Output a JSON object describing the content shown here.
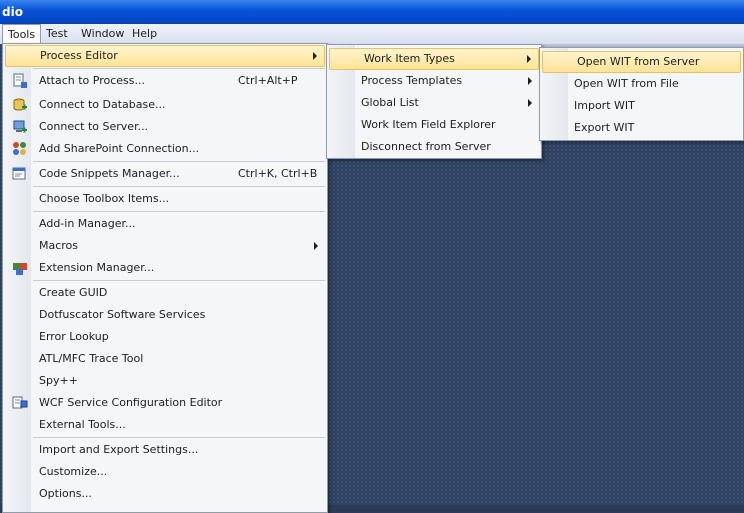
{
  "window": {
    "title_fragment": "dio"
  },
  "menubar": {
    "items": [
      "Tools",
      "Test",
      "Window",
      "Help"
    ]
  },
  "tools_menu": {
    "items": [
      {
        "label": "Process Editor",
        "has_submenu": true
      },
      {
        "label": "Attach to Process...",
        "shortcut": "Ctrl+Alt+P"
      },
      {
        "label": "Connect to Database..."
      },
      {
        "label": "Connect to Server..."
      },
      {
        "label": "Add SharePoint Connection..."
      },
      {
        "label": "Code Snippets Manager...",
        "shortcut": "Ctrl+K, Ctrl+B"
      },
      {
        "label": "Choose Toolbox Items..."
      },
      {
        "label": "Add-in Manager..."
      },
      {
        "label": "Macros",
        "has_submenu": true
      },
      {
        "label": "Extension Manager..."
      },
      {
        "label": "Create GUID"
      },
      {
        "label": "Dotfuscator Software Services"
      },
      {
        "label": "Error Lookup"
      },
      {
        "label": "ATL/MFC Trace Tool"
      },
      {
        "label": "Spy++"
      },
      {
        "label": "WCF Service Configuration Editor"
      },
      {
        "label": "External Tools..."
      },
      {
        "label": "Import and Export Settings..."
      },
      {
        "label": "Customize..."
      },
      {
        "label": "Options..."
      }
    ]
  },
  "process_editor_menu": {
    "items": [
      {
        "label": "Work Item Types",
        "has_submenu": true
      },
      {
        "label": "Process Templates",
        "has_submenu": true
      },
      {
        "label": "Global List",
        "has_submenu": true
      },
      {
        "label": "Work Item Field Explorer"
      },
      {
        "label": "Disconnect from Server"
      }
    ]
  },
  "work_item_types_menu": {
    "items": [
      {
        "label": "Open WIT from Server"
      },
      {
        "label": "Open WIT from File"
      },
      {
        "label": "Import WIT"
      },
      {
        "label": "Export WIT"
      }
    ]
  }
}
